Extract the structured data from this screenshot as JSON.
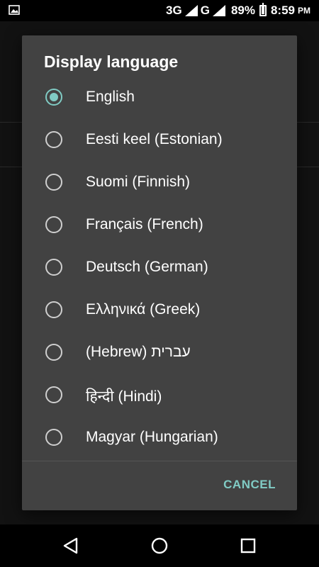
{
  "status_bar": {
    "network_1": "3G",
    "network_2": "G",
    "battery": "89%",
    "battery_level": 0.89,
    "time": "8:59",
    "time_suffix": "PM",
    "notification_icon": "image-icon"
  },
  "dialog": {
    "title": "Display language",
    "options": [
      {
        "label": "English",
        "checked": true
      },
      {
        "label": "Eesti keel (Estonian)",
        "checked": false
      },
      {
        "label": "Suomi (Finnish)",
        "checked": false
      },
      {
        "label": "Français (French)",
        "checked": false
      },
      {
        "label": "Deutsch (German)",
        "checked": false
      },
      {
        "label": "Ελληνικά (Greek)",
        "checked": false
      },
      {
        "label": "(Hebrew) עברית",
        "checked": false
      },
      {
        "label": "हिन्दी (Hindi)",
        "checked": false
      },
      {
        "label": "Magyar (Hungarian)",
        "checked": false
      }
    ],
    "cancel_label": "CANCEL",
    "accent_color": "#80cbc4"
  },
  "nav_bar": {
    "back_icon": "back-triangle-icon",
    "home_icon": "home-circle-icon",
    "recents_icon": "recents-square-icon"
  }
}
